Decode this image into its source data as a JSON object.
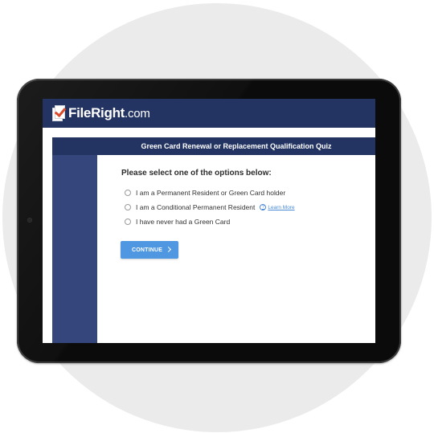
{
  "header": {
    "logo_brand": "FileRight",
    "logo_domain": ".com",
    "logo_icon": "document-check-icon"
  },
  "quiz": {
    "title": "Green Card Renewal or Replacement Qualification Quiz",
    "prompt": "Please select one of the options below:",
    "options": [
      {
        "label": "I am a Permanent Resident or Green Card holder",
        "selected": false
      },
      {
        "label": "I am a Conditional Permanent Resident",
        "selected": false,
        "link": "Learn More"
      },
      {
        "label": "I have never had a Green Card",
        "selected": false
      }
    ],
    "continue_label": "CONTINUE",
    "continue_icon": "chevron-right-icon"
  },
  "colors": {
    "header_navy": "#243462",
    "sidebar_blue": "#35467d",
    "button_blue": "#4f97e0",
    "link_blue": "#4a8ad4",
    "check_red": "#d84a2b"
  }
}
